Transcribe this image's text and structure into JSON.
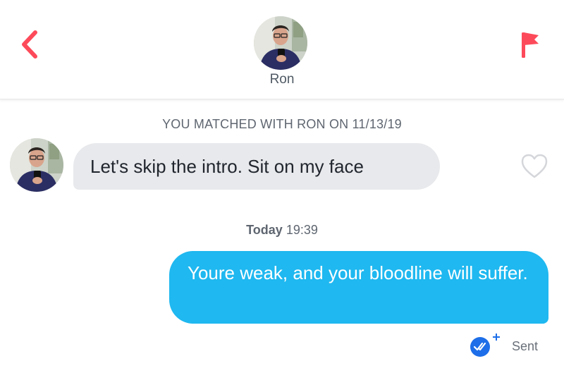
{
  "header": {
    "back_icon": "chevron-left-icon",
    "match_name": "Ron",
    "flag_icon": "report-flag-icon"
  },
  "match_info": {
    "text": "YOU MATCHED WITH RON ON 11/13/19"
  },
  "messages": [
    {
      "direction": "incoming",
      "text": "Let's skip the intro. Sit on my face",
      "like_icon": "heart-outline-icon"
    },
    {
      "direction": "outgoing",
      "text": "Youre weak, and your bloodline will suffer."
    }
  ],
  "timestamp": {
    "day": "Today",
    "time": "19:39"
  },
  "status": {
    "read_receipt_icon": "read-receipt-check-icon",
    "label": "Sent"
  },
  "colors": {
    "accent_red": "#fd4a5a",
    "outgoing_bubble": "#1fb8f0",
    "incoming_bubble": "#e8e9ec",
    "receipt_blue": "#1d6ee8"
  }
}
